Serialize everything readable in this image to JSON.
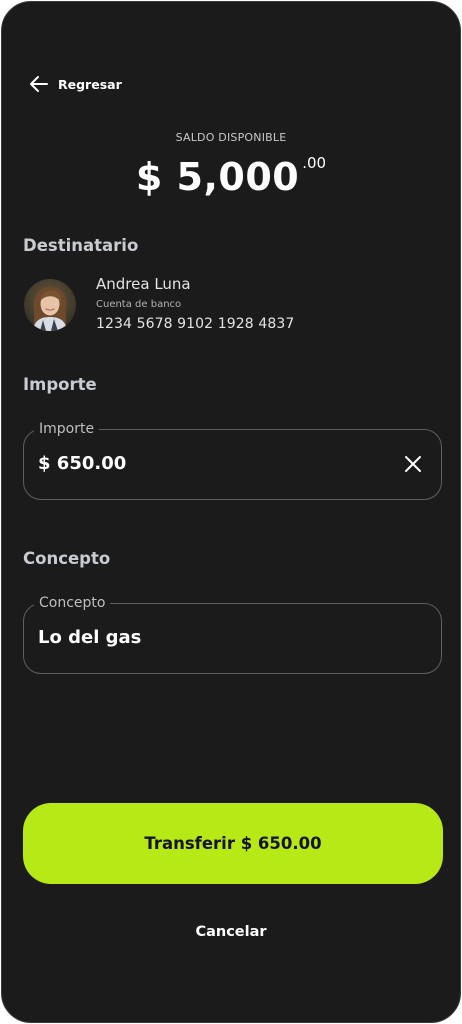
{
  "header": {
    "back_label": "Regresar"
  },
  "balance": {
    "label": "SALDO DISPONIBLE",
    "amount": "$ 5,000",
    "cents": ".00"
  },
  "recipient": {
    "section_title": "Destinatario",
    "name": "Andrea Luna",
    "account_type": "Cuenta de banco",
    "account_number": "1234 5678 9102 1928 4837"
  },
  "amount_section": {
    "section_title": "Importe",
    "field_label": "Importe",
    "field_value": "$ 650.00"
  },
  "concept_section": {
    "section_title": "Concepto",
    "field_label": "Concepto",
    "field_value": "Lo del gas"
  },
  "actions": {
    "primary_label": "Transferir $ 650.00",
    "secondary_label": "Cancelar"
  },
  "icons": {
    "back": "arrow-left-icon",
    "clear": "close-icon"
  },
  "colors": {
    "background": "#1b1b1b",
    "accent": "#b6e916",
    "text": "#ffffff"
  }
}
